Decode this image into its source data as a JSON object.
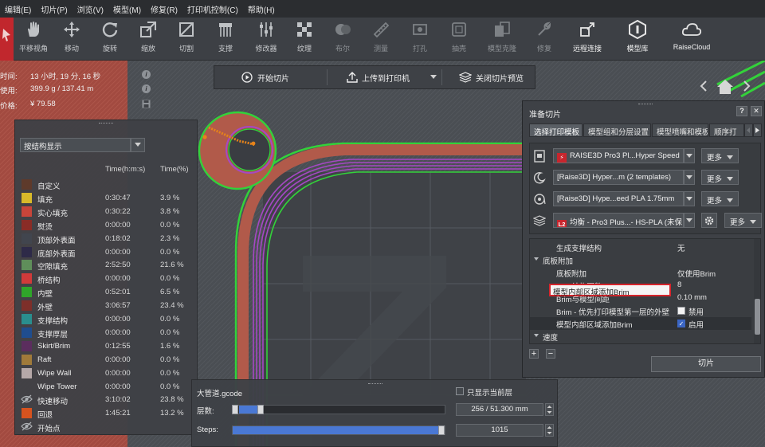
{
  "menu": [
    "编辑(E)",
    "切片(P)",
    "浏览(V)",
    "模型(M)",
    "修复(R)",
    "打印机控制(C)",
    "帮助(H)"
  ],
  "toolbar": [
    {
      "label": "平移视角",
      "icon": "hand-icon"
    },
    {
      "label": "移动",
      "icon": "move-icon"
    },
    {
      "label": "旋转",
      "icon": "rotate-icon"
    },
    {
      "label": "缩放",
      "icon": "scale-icon"
    },
    {
      "label": "切割",
      "icon": "cut-icon"
    },
    {
      "label": "支撑",
      "icon": "support-icon"
    },
    {
      "label": "修改器",
      "icon": "modifier-icon"
    },
    {
      "label": "纹理",
      "icon": "texture-icon"
    },
    {
      "label": "布尔",
      "icon": "boolean-icon"
    },
    {
      "label": "测量",
      "icon": "measure-icon"
    },
    {
      "label": "打孔",
      "icon": "drill-icon"
    },
    {
      "label": "抽壳",
      "icon": "shell-icon"
    },
    {
      "label": "模型克隆",
      "icon": "clone-icon"
    },
    {
      "label": "修复",
      "icon": "repair-icon"
    },
    {
      "label": "远程连接",
      "icon": "remote-connect-icon"
    },
    {
      "label": "模型库",
      "icon": "model-library-icon"
    },
    {
      "label": "RaiseCloud",
      "icon": "cloud-icon"
    }
  ],
  "stats": {
    "time_label": "时间:",
    "time_value": "13 小时, 19 分, 16 秒",
    "usage_label": "使用:",
    "usage_value": "399.9 g / 137.41 m",
    "price_label": "价格:",
    "price_value": "¥ 79.58"
  },
  "actions": {
    "start_slice": "开始切片",
    "upload": "上传到打印机",
    "close_preview": "关闭切片预览"
  },
  "legend": {
    "select_value": "按结构显示",
    "col_time": "Time(h:m:s)",
    "col_pct": "Time(%)",
    "rows": [
      {
        "name": "自定义",
        "time": "",
        "pct": "",
        "color": "#5e3a2b"
      },
      {
        "name": "填充",
        "time": "0:30:47",
        "pct": "3.9 %",
        "color": "#d8b92a"
      },
      {
        "name": "实心填充",
        "time": "0:30:22",
        "pct": "3.8 %",
        "color": "#c8453a"
      },
      {
        "name": "熨烫",
        "time": "0:00:00",
        "pct": "0.0 %",
        "color": "#8a2c26"
      },
      {
        "name": "顶部外表面",
        "time": "0:18:02",
        "pct": "2.3 %",
        "color": "#41454e"
      },
      {
        "name": "底部外表面",
        "time": "0:00:00",
        "pct": "0.0 %",
        "color": "#2e2a48"
      },
      {
        "name": "空隙填充",
        "time": "2:52:50",
        "pct": "21.6 %",
        "color": "#5f8e5a"
      },
      {
        "name": "桥结构",
        "time": "0:00:00",
        "pct": "0.0 %",
        "color": "#d13a3a"
      },
      {
        "name": "内壁",
        "time": "0:52:01",
        "pct": "6.5 %",
        "color": "#2fa52a"
      },
      {
        "name": "外壁",
        "time": "3:06:57",
        "pct": "23.4 %",
        "color": "#7e2f2a"
      },
      {
        "name": "支撑结构",
        "time": "0:00:00",
        "pct": "0.0 %",
        "color": "#2a8e8e"
      },
      {
        "name": "支撑厚层",
        "time": "0:00:00",
        "pct": "0.0 %",
        "color": "#1f4d8e"
      },
      {
        "name": "Skirt/Brim",
        "time": "0:12:55",
        "pct": "1.6 %",
        "color": "#5b2d5e"
      },
      {
        "name": "Raft",
        "time": "0:00:00",
        "pct": "0.0 %",
        "color": "#a07a3a"
      },
      {
        "name": "Wipe Wall",
        "time": "0:00:00",
        "pct": "0.0 %",
        "color": "#b5a8a8"
      },
      {
        "name": "Wipe Tower",
        "time": "0:00:00",
        "pct": "0.0 %",
        "color": ""
      },
      {
        "name": "快速移动",
        "time": "3:10:02",
        "pct": "23.8 %",
        "color": "eye"
      },
      {
        "name": "回退",
        "time": "1:45:21",
        "pct": "13.2 %",
        "color": "#d6531f"
      },
      {
        "name": "开始点",
        "time": "",
        "pct": "",
        "color": "eye"
      }
    ]
  },
  "gcode": {
    "filename": "大管道.gcode",
    "only_current_layer": "只显示当前层",
    "layers_label": "层数:",
    "layers_value": "256 / 51.300 mm",
    "layers_progress": 0.115,
    "steps_label": "Steps:",
    "steps_value": "1015",
    "steps_progress": 1.0
  },
  "prep": {
    "title": "准备切片",
    "help": "?",
    "close": "✕",
    "tabs": [
      "选择打印模板",
      "模型组和分层设置",
      "模型喷嘴和模板",
      "顺序打"
    ],
    "printer": "RAISE3D Pro3 Pl...Hyper Speed",
    "template": "[Raise3D] Hyper...m (2 templates)",
    "filament": "[Raise3D] Hype...eed PLA 1.75mm",
    "process_badge": "L2",
    "process": "均衡 - Pro3 Plus...- HS-PLA (未保",
    "more": "更多",
    "settings": [
      {
        "name": "生成支撑结构",
        "value": "无",
        "type": "text"
      },
      {
        "name": "底板附加",
        "value": "",
        "type": "group"
      },
      {
        "name": "底板附加",
        "value": "仅使用Brim",
        "type": "text"
      },
      {
        "name": "Brim结构圈数",
        "value": "8",
        "type": "text"
      },
      {
        "name": "Brim与模型间距",
        "value": "0.10 mm",
        "type": "text"
      },
      {
        "name": "Brim - 优先打印模型第一层的外壁",
        "value": "禁用",
        "type": "check-off"
      },
      {
        "name": "模型内部区域添加Brim",
        "value": "启用",
        "type": "check-on"
      },
      {
        "name": "速度",
        "value": "",
        "type": "group"
      }
    ],
    "add": "+",
    "remove": "−",
    "slice_button": "切片"
  }
}
